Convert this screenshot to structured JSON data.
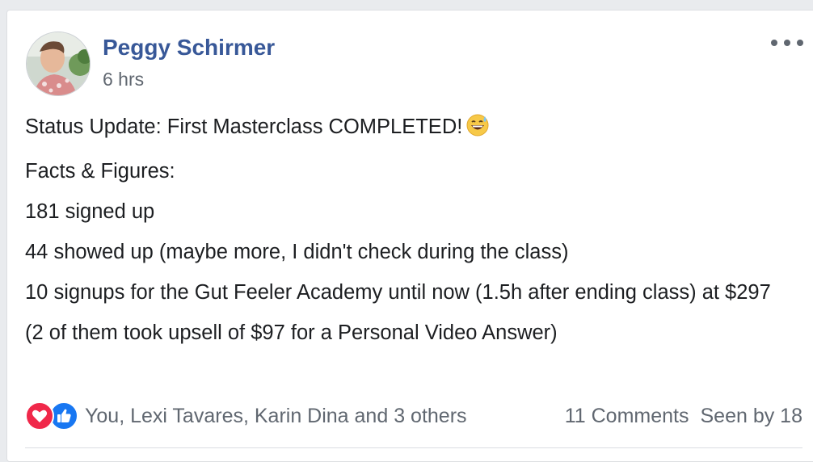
{
  "post": {
    "author": "Peggy Schirmer",
    "time": "6 hrs",
    "lines": [
      "Status Update: First Masterclass COMPLETED!",
      "Facts & Figures:",
      "181 signed up",
      "44 showed up (maybe more, I didn't check during the class)",
      "10 signups for the Gut Feeler Academy until now (1.5h after ending class) at $297",
      "(2 of them took upsell of $97 for a Personal Video Answer)"
    ],
    "emoji": "grinning-sweat-emoji"
  },
  "footer": {
    "reactions_text": "You, Lexi Tavares, Karin Dina and 3 others",
    "comments": "11 Comments",
    "seen": "Seen by 18",
    "reaction_icons": [
      "love-icon",
      "like-icon"
    ]
  },
  "colors": {
    "author": "#385898",
    "meta": "#606770",
    "text": "#1c1e21",
    "love": "#f0284a",
    "like": "#1877f2"
  }
}
